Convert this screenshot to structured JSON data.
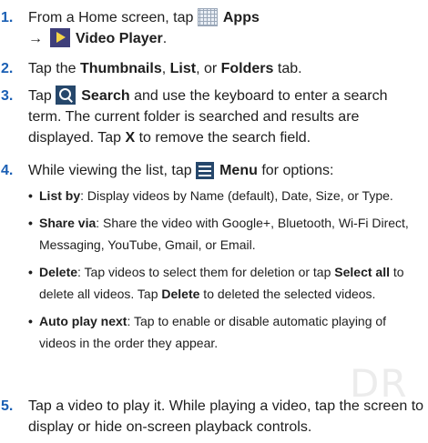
{
  "steps": [
    {
      "number": "1.",
      "pre": "From a Home screen, tap",
      "apps_label": "Apps",
      "arrow": "→",
      "video_label": "Video Player",
      "end": "."
    },
    {
      "number": "2.",
      "parts": [
        "Tap the ",
        "Thumbnails",
        ", ",
        "List",
        ", or ",
        "Folders",
        " tab."
      ]
    },
    {
      "number": "3.",
      "pre": "Tap",
      "search_label": "Search",
      "rest": "and use the keyboard to enter a search term. The current folder is searched and results are displayed. Tap",
      "x_label": "X",
      "rest2": "to remove the search field."
    },
    {
      "number": "4.",
      "pre": "While viewing the list, tap",
      "menu_label": "Menu",
      "rest": "for options:"
    },
    {
      "number": "5.",
      "text": "Tap a video to play it. While playing a video, tap the screen to display or hide on-screen playback controls."
    }
  ],
  "options": [
    {
      "label": "List by",
      "text": ": Display videos by Name (default), Date, Size, or Type."
    },
    {
      "label": "Share via",
      "text": ": Share the video with Google+, Bluetooth, Wi-Fi Direct, Messaging, YouTube, Gmail, or Email."
    },
    {
      "label": "Delete",
      "text": ": Tap videos to select them for deletion or tap ",
      "select_all": "Select all",
      "text2": " to delete all videos. Tap ",
      "delete2": "Delete",
      "text3": " to deleted the selected videos."
    },
    {
      "label": "Auto play next",
      "text": ": Tap to enable or disable automatic playing of videos in the order they appear."
    }
  ],
  "watermark": "DR"
}
